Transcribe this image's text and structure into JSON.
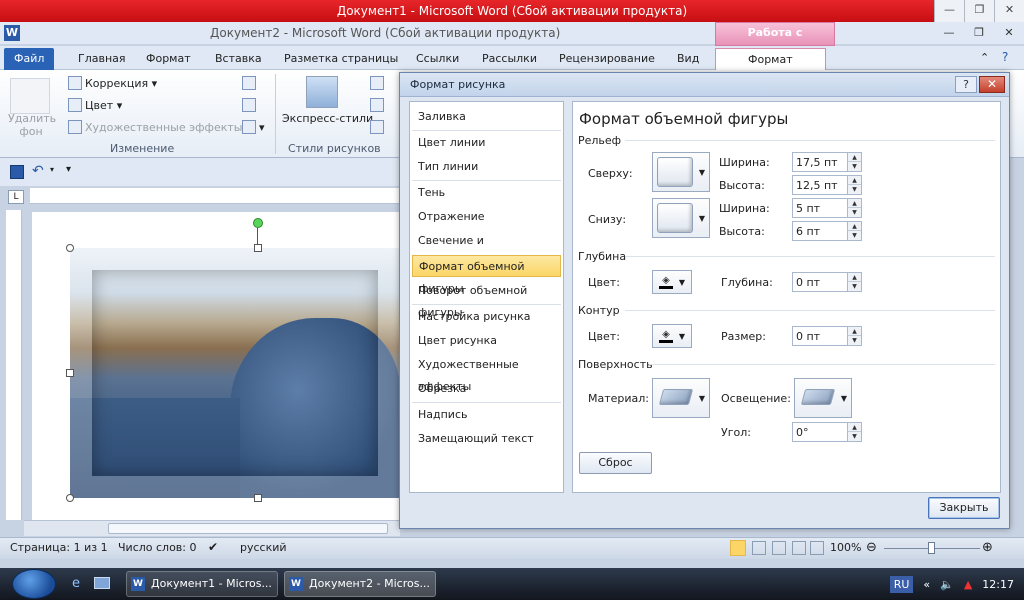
{
  "window": {
    "outer_title": "Документ1  -  Microsoft Word (Сбой активации продукта)",
    "inner_title": "Документ2  -  Microsoft Word (Сбой активации продукта)",
    "picture_tools": "Работа с рисунками",
    "word_logo": "W"
  },
  "ribbon": {
    "tabs": [
      "Файл",
      "Главная",
      "Формат",
      "Вставка",
      "Разметка страницы",
      "Ссылки",
      "Рассылки",
      "Рецензирование",
      "Вид",
      "Формат"
    ],
    "remove_bg": "Удалить фон",
    "correction": "Коррекция",
    "color": "Цвет",
    "art_effects": "Художественные эффекты",
    "group_adjust": "Изменение",
    "express_styles": "Экспресс-стили",
    "group_styles": "Стили рисунков"
  },
  "dialog": {
    "title": "Формат рисунка",
    "help": "?",
    "close_x": "✕",
    "nav": [
      "Заливка",
      "Цвет линии",
      "Тип линии",
      "Тень",
      "Отражение",
      "Свечение и сглаживание",
      "Формат объемной фигуры",
      "Поворот объемной фигуры",
      "Настройка рисунка",
      "Цвет рисунка",
      "Художественные эффекты",
      "Обрезка",
      "Надпись",
      "Замещающий текст"
    ],
    "pane_title": "Формат объемной фигуры",
    "relief": {
      "section": "Рельеф",
      "top": "Сверху:",
      "bottom": "Снизу:",
      "width": "Ширина:",
      "height": "Высота:",
      "top_width": "17,5 пт",
      "top_height": "12,5 пт",
      "bottom_width": "5 пт",
      "bottom_height": "6 пт"
    },
    "depth": {
      "section": "Глубина",
      "color": "Цвет:",
      "depth_label": "Глубина:",
      "depth_value": "0 пт"
    },
    "contour": {
      "section": "Контур",
      "color": "Цвет:",
      "size_label": "Размер:",
      "size_value": "0 пт"
    },
    "surface": {
      "section": "Поверхность",
      "material": "Материал:",
      "lighting": "Освещение:",
      "angle_label": "Угол:",
      "angle_value": "0°"
    },
    "reset": "Сброс",
    "close": "Закрыть"
  },
  "status": {
    "page": "Страница: 1 из 1",
    "words": "Число слов: 0",
    "lang": "русский",
    "zoom": "100%"
  },
  "taskbar": {
    "doc1": "Документ1 - Micros...",
    "doc2": "Документ2 - Micros...",
    "lang": "RU",
    "time": "12:17"
  }
}
